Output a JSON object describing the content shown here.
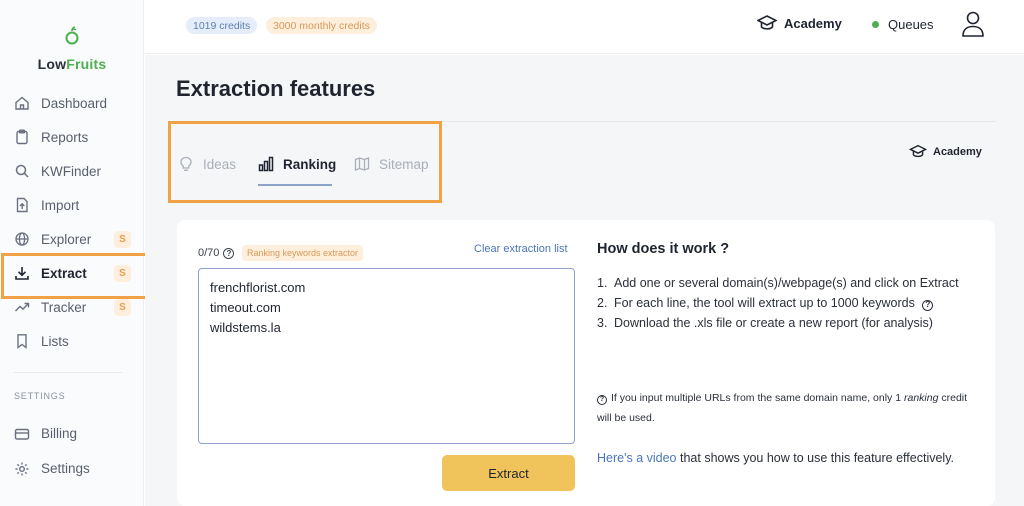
{
  "brand": {
    "name_part1": "Low",
    "name_part2": "Fruits"
  },
  "sidebar": {
    "items": [
      {
        "label": "Dashboard",
        "icon": "home-icon"
      },
      {
        "label": "Reports",
        "icon": "clipboard-icon"
      },
      {
        "label": "KWFinder",
        "icon": "search-icon"
      },
      {
        "label": "Import",
        "icon": "upload-file-icon"
      },
      {
        "label": "Explorer",
        "icon": "globe-icon",
        "badge": "S"
      },
      {
        "label": "Extract",
        "icon": "download-icon",
        "badge": "S",
        "active": true
      },
      {
        "label": "Tracker",
        "icon": "trend-icon",
        "badge": "S"
      },
      {
        "label": "Lists",
        "icon": "bookmark-icon"
      }
    ],
    "settings_heading": "SETTINGS",
    "settings_items": [
      {
        "label": "Billing",
        "icon": "credit-card-icon"
      },
      {
        "label": "Settings",
        "icon": "gear-icon"
      }
    ]
  },
  "topbar": {
    "credits": "1019 credits",
    "monthly_credits": "3000 monthly credits",
    "academy": "Academy",
    "queues": "Queues",
    "status_color": "#4caf50"
  },
  "page": {
    "title": "Extraction features",
    "tabs": [
      {
        "label": "Ideas",
        "icon": "lightbulb-icon"
      },
      {
        "label": "Ranking",
        "icon": "bar-chart-icon",
        "active": true
      },
      {
        "label": "Sitemap",
        "icon": "map-icon"
      }
    ],
    "academy_link": "Academy"
  },
  "form": {
    "counter": "0/70",
    "tag": "Ranking keywords extractor",
    "clear_link": "Clear extraction list",
    "lines": [
      "frenchflorist.com",
      "timeout.com",
      "wildstems.la"
    ],
    "extract_button": "Extract"
  },
  "help": {
    "title": "How does it work ?",
    "steps": [
      {
        "num": "1.",
        "text": "Add one or several domain(s)/webpage(s) and click on Extract"
      },
      {
        "num": "2.",
        "text": "For each line, the tool will extract up to 1000 keywords"
      },
      {
        "num": "3.",
        "text": "Download the .xls file or create a new report (for analysis)"
      }
    ],
    "note_before": "If you input multiple URLs from the same domain name, only 1",
    "note_emphasis": "ranking",
    "note_after": "credit will be used.",
    "video_link": "Here's a video",
    "video_rest": "that shows you how to use this feature effectively."
  },
  "colors": {
    "accent_orange": "#f0a245",
    "link_blue": "#4a76b8",
    "button_yellow": "#f0c45a"
  }
}
